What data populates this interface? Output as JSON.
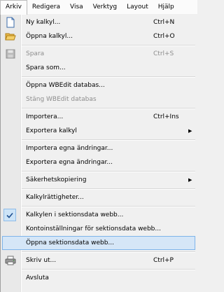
{
  "menubar": {
    "items": [
      {
        "label": "Arkiv"
      },
      {
        "label": "Redigera"
      },
      {
        "label": "Visa"
      },
      {
        "label": "Verktyg"
      },
      {
        "label": "Layout"
      },
      {
        "label": "Hjälp"
      }
    ]
  },
  "menu": {
    "items": [
      {
        "label": "Ny kalkyl...",
        "shortcut": "Ctrl+N",
        "icon": "new-document-icon"
      },
      {
        "label": "Öppna kalkyl...",
        "shortcut": "Ctrl+O",
        "icon": "open-folder-icon"
      },
      {
        "label": "Spara",
        "shortcut": "Ctrl+S",
        "icon": "save-disk-icon",
        "disabled": true
      },
      {
        "label": "Spara som..."
      },
      {
        "label": "Öppna WBEdit databas..."
      },
      {
        "label": "Stäng WBEdit databas",
        "disabled": true
      },
      {
        "label": "Importera...",
        "shortcut": "Ctrl+Ins"
      },
      {
        "label": "Exportera kalkyl",
        "submenu": true
      },
      {
        "label": "Importera egna ändringar..."
      },
      {
        "label": "Exportera egna ändringar..."
      },
      {
        "label": "Säkerhetskopiering",
        "submenu": true
      },
      {
        "label": "Kalkylrättigheter..."
      },
      {
        "label": "Kalkylen i sektionsdata webb...",
        "checked": true
      },
      {
        "label": "Kontoinställningar för sektionsdata webb..."
      },
      {
        "label": "Öppna sektionsdata webb...",
        "highlighted": true
      },
      {
        "label": "Skriv ut...",
        "shortcut": "Ctrl+P",
        "icon": "printer-icon"
      },
      {
        "label": "Avsluta"
      }
    ]
  },
  "colors": {
    "highlight_fill": "#d5e6f7",
    "highlight_border": "#7eb4ea",
    "disabled_text": "#8d8d8d",
    "check_fill": "#cde4f7"
  }
}
